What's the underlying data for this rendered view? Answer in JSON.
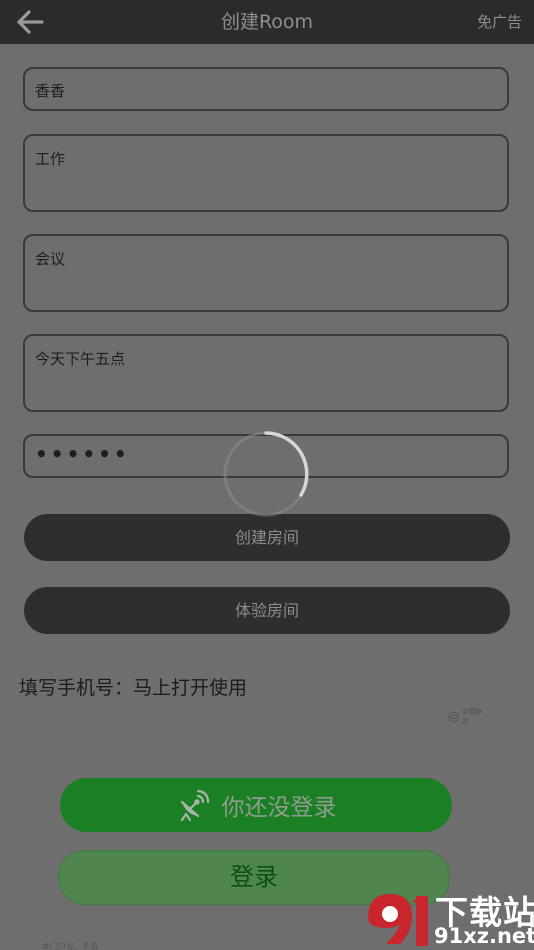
{
  "header": {
    "title": "创建Room",
    "action_label": "免广告"
  },
  "form": {
    "name_value": "香香",
    "category_value": "工作",
    "topic_value": "会议",
    "time_value": "今天下午五点",
    "password_masked": "••••••"
  },
  "buttons": {
    "create_room": "创建房间",
    "experience_room": "体验房间",
    "login_status": "你还没登录",
    "login": "登录"
  },
  "hint": {
    "phone_prompt": "填写手机号：马上打开使用"
  },
  "logo": {
    "small_text": "中国移动"
  },
  "footer": {
    "text": "本门户号，手游"
  },
  "watermark": {
    "top_text": "下载站",
    "bottom_text": "91xz.net",
    "logo_number": "9"
  },
  "colors": {
    "topbar": "#2b2b2b",
    "overlay": "#6e6e6e",
    "primary_green": "#1b7f23",
    "login_green": "#4f854f",
    "watermark_red": "#c8252c"
  },
  "icons": {
    "back": "arrow-left-icon",
    "satellite": "satellite-dish-icon",
    "spinner": "loading-spinner-icon"
  }
}
